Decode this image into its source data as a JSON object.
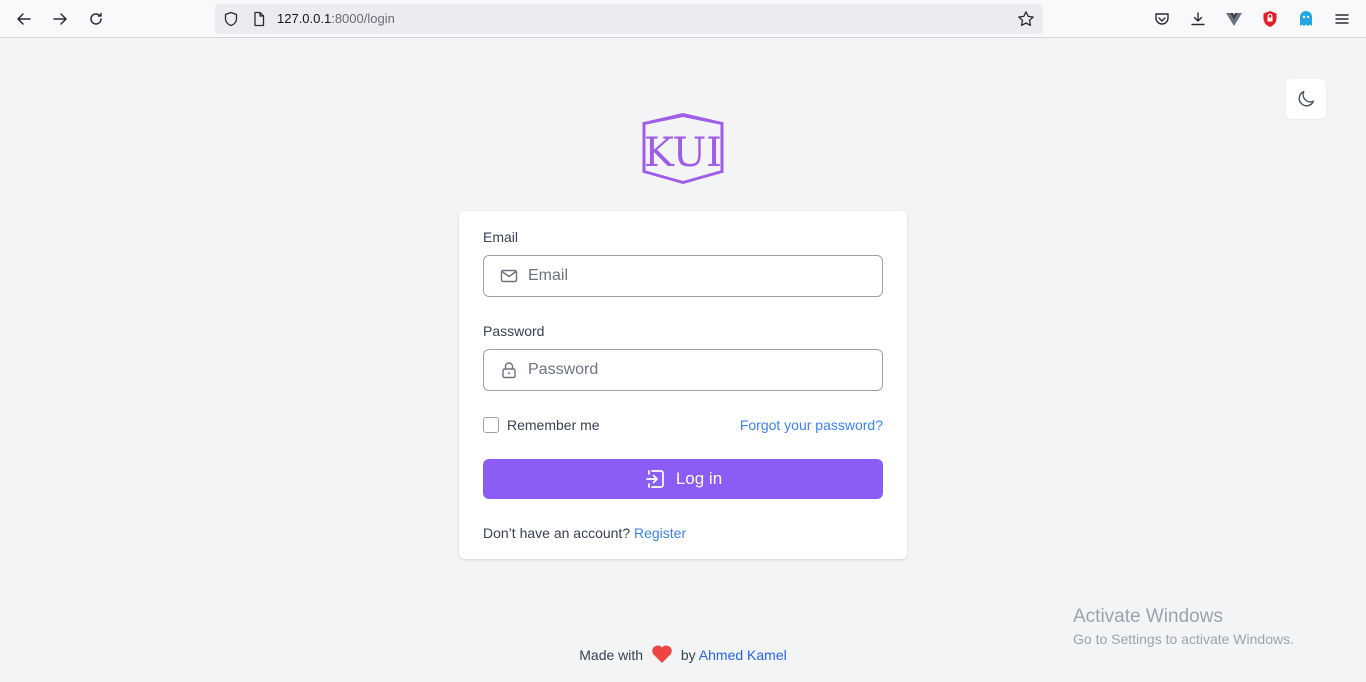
{
  "browser": {
    "url_host": "127.0.0.1",
    "url_rest": ":8000/login"
  },
  "form": {
    "email_label": "Email",
    "email_placeholder": "Email",
    "password_label": "Password",
    "password_placeholder": "Password",
    "remember_label": "Remember me",
    "forgot_link": "Forgot your password?",
    "login_button": "Log in",
    "no_account_text": "Don’t have an account?",
    "register_link": "Register"
  },
  "footer": {
    "made_with": "Made with",
    "by": "by",
    "author": "Ahmed Kamel"
  },
  "watermark": {
    "title": "Activate Windows",
    "subtitle": "Go to Settings to activate Windows."
  },
  "logo": {
    "text": "KUI"
  },
  "colors": {
    "accent": "#8b5cf6",
    "link": "#3b82f6",
    "heart": "#ef4444"
  }
}
